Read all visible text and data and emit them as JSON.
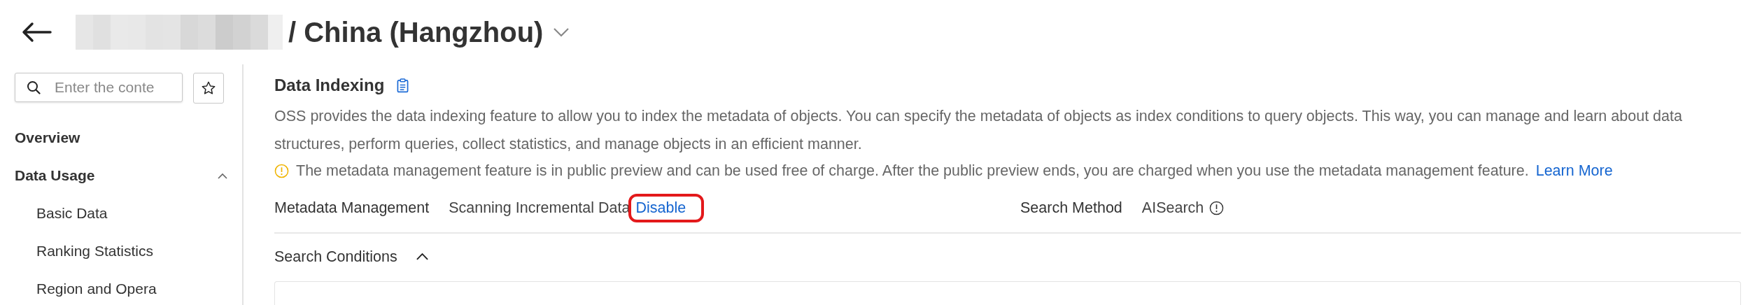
{
  "header": {
    "title": "/ China (Hangzhou)"
  },
  "sidebar": {
    "search": {
      "placeholder": "Enter the conte"
    },
    "items": [
      {
        "label": "Overview"
      },
      {
        "label": "Data Usage",
        "expanded": true,
        "children": [
          {
            "label": "Basic Data"
          },
          {
            "label": "Ranking Statistics"
          },
          {
            "label": "Region and Opera"
          }
        ]
      }
    ]
  },
  "main": {
    "title": "Data Indexing",
    "description": "OSS provides the data indexing feature to allow you to index the metadata of objects. You can specify the metadata of objects as index conditions to query objects. This way, you can manage and learn about data structures, perform queries, collect statistics, and manage objects in an efficient manner.",
    "notice": {
      "text": "The metadata management feature is in public preview and can be used free of charge. After the public preview ends, you are charged when you use the metadata management feature.",
      "link": "Learn More"
    },
    "fields": [
      {
        "label": "Metadata Management",
        "value": "Scanning Incremental Data",
        "action": "Disable",
        "highlighted": true,
        "info": false
      },
      {
        "label": "Search Method",
        "value": "AISearch",
        "info": true
      }
    ],
    "search_conditions": {
      "label": "Search Conditions",
      "expanded": true
    }
  }
}
